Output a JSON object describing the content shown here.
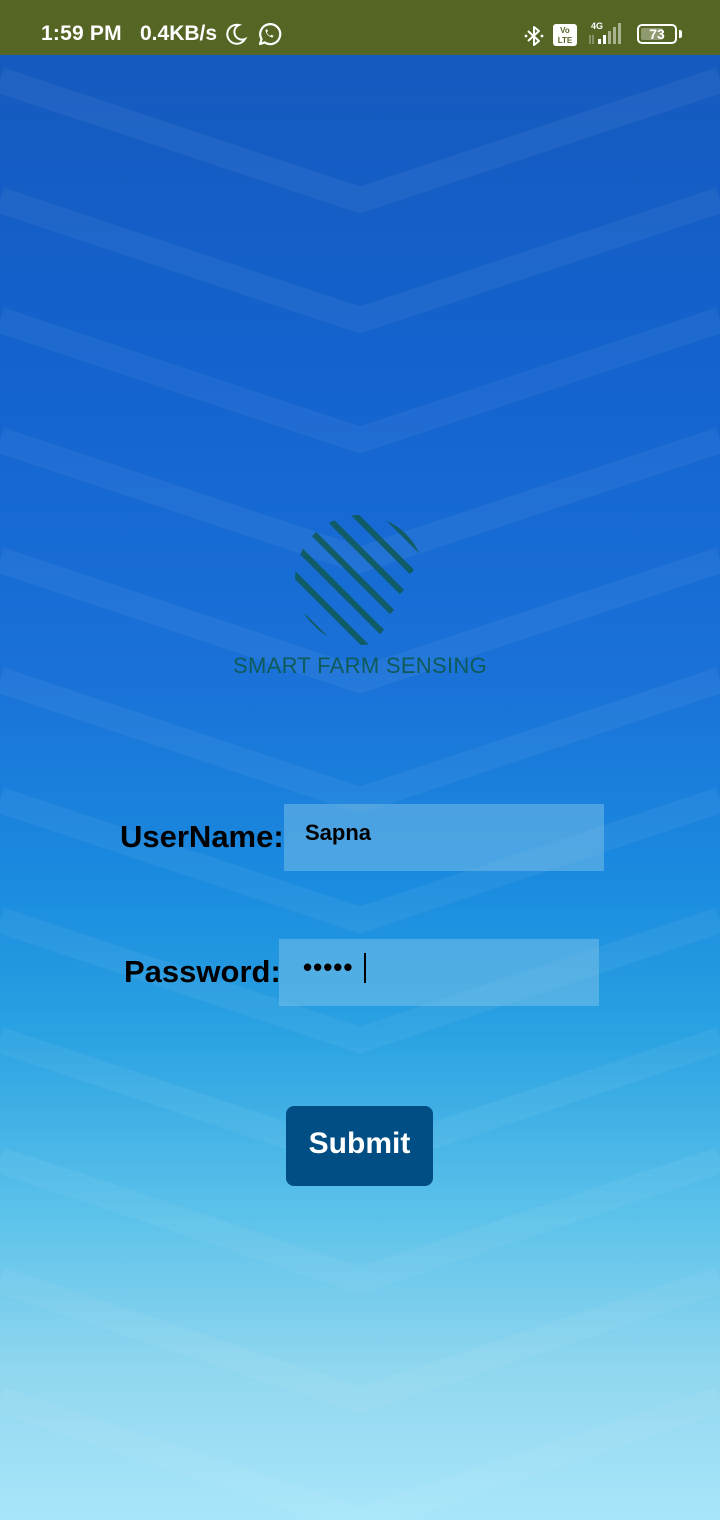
{
  "status_bar": {
    "time": "1:59 PM",
    "net_speed": "0.4KB/s",
    "battery": "73",
    "battery_level_percent": 73,
    "network": "4G",
    "volte": "Vo LTE",
    "icons": [
      "moon-icon",
      "whatsapp-icon",
      "bluetooth-icon",
      "volte-icon",
      "signal-icon",
      "battery-icon"
    ]
  },
  "logo": {
    "text": "SMART FARM SENSING",
    "color": "#0f5a5a"
  },
  "form": {
    "username_label": "UserName:",
    "username_value": "Sapna",
    "password_label": "Password:",
    "password_masked": "•••••",
    "submit_label": "Submit"
  },
  "colors": {
    "status_bar": "#546524",
    "submit_button": "#014e84",
    "background_top": "#1558bb",
    "background_bottom": "#a9e6fa"
  }
}
